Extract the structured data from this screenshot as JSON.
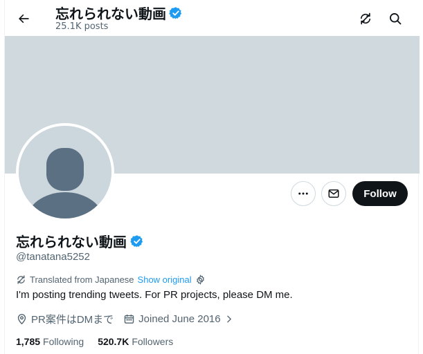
{
  "header": {
    "title": "忘れられない動画",
    "posts": "25.1K posts"
  },
  "profile": {
    "name": "忘れられない動画",
    "handle": "@tanatana5252",
    "follow_label": "Follow",
    "translated_label": "Translated from Japanese",
    "show_original": "Show original",
    "bio": "I'm posting trending tweets. For PR projects, please DM me.",
    "location": "PR案件はDMまで",
    "joined": "Joined June 2016",
    "following_count": "1,785",
    "following_label": "Following",
    "followers_count": "520.7K",
    "followers_label": "Followers"
  },
  "icons": {
    "back": "arrow-left-icon",
    "translate": "translate-icon",
    "search": "search-icon",
    "more": "more-icon",
    "message": "mail-icon",
    "verified": "verified-badge-icon",
    "location": "location-icon",
    "calendar": "calendar-icon",
    "gear": "gear-icon"
  },
  "colors": {
    "banner": "#cfd9de",
    "verified": "#1d9bf0",
    "link": "#1d9bf0",
    "primary_text": "#0f1419",
    "secondary_text": "#536471",
    "follow_bg": "#0f1419"
  }
}
